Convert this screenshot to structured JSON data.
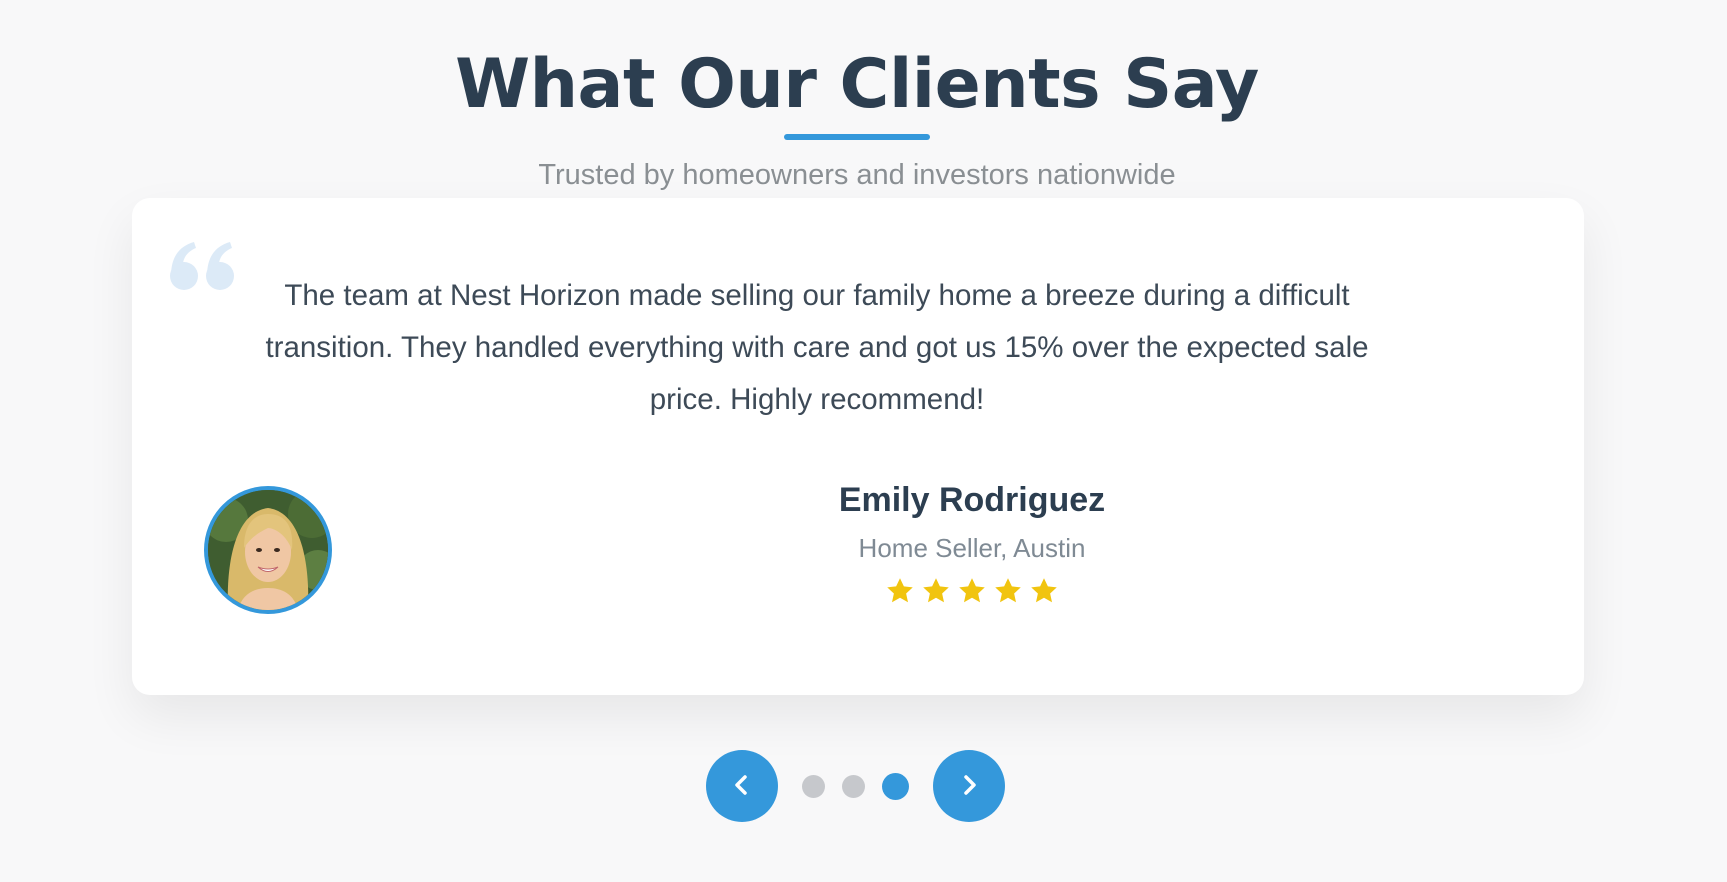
{
  "section": {
    "title": "What Our Clients Say",
    "subtitle": "Trusted by homeowners and investors nationwide"
  },
  "testimonial": {
    "quote": "The team at Nest Horizon made selling our family home a breeze during a difficult transition. They handled everything with care and got us 15% over the expected sale price. Highly recommend!",
    "author_name": "Emily Rodriguez",
    "author_role": "Home Seller, Austin",
    "rating": 5,
    "rating_max": 5
  },
  "carousel": {
    "slide_count": 3,
    "active_slide": 3,
    "prev_icon": "chevron-left-icon",
    "next_icon": "chevron-right-icon"
  },
  "colors": {
    "accent": "#3498db",
    "heading": "#2c3e50",
    "star": "#f1c40f",
    "dot_inactive": "#c6c8cc",
    "quote_mark": "#dceaf7"
  }
}
